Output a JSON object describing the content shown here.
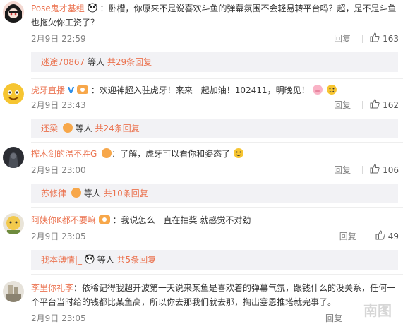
{
  "comments": [
    {
      "user": "Pose鬼才基组",
      "text": "：卧槽，你原来不是说喜欢斗鱼的弹幕氛围不会轻易转平台吗？超，是不是斗鱼",
      "text2": "也拖欠你工资了？",
      "date": "2月9日 22:59",
      "reply": "回复",
      "likes": "163",
      "sub_user": "迷途70867",
      "sub_text": "等人",
      "sub_count": "共29条回复"
    },
    {
      "user": "虎牙直播",
      "text": "：欢迎神超入驻虎牙！来来一起加油！102411，明晚见！",
      "date": "2月9日 23:43",
      "reply": "回复",
      "likes": "162",
      "sub_user": "还梁",
      "sub_text": "等人",
      "sub_count": "共24条回复"
    },
    {
      "user": "搾木剑的温不胜G",
      "text": "：了解，虎牙可以看你和姿态了",
      "date": "2月9日 23:00",
      "reply": "回复",
      "likes": "106",
      "sub_user": "苏修律",
      "sub_text": "等人",
      "sub_count": "共10条回复"
    },
    {
      "user": "阿姨你K都不要嘛",
      "text": "：我说怎么一直在抽奖   就感觉不对劲",
      "date": "2月9日 23:05",
      "reply": "回复",
      "likes": "49",
      "sub_user": "我本薄情|_",
      "sub_text": "等人",
      "sub_count": "共5条回复"
    },
    {
      "user": "李里你礼李",
      "text": "：依稀记得我超开波第一天说来某鱼是喜欢着的弹幕气氛，跟钱什么的没关系，任何一",
      "text2": "个平台当时给的钱都比某鱼高，所以你去那我们就去那，掏出塞恩推塔就完事了。",
      "date": "2月9日 23:05",
      "reply": "回复",
      "likes": ""
    }
  ],
  "watermark": "南图",
  "colors": {
    "username": "#eb7350",
    "meta": "#808080",
    "subbox": "#f2f2f5"
  },
  "icons": [
    "panda-emoji-icon",
    "verified-v-icon",
    "vip-badge-icon",
    "smile-emoji-icon",
    "thumbs-up-icon"
  ]
}
